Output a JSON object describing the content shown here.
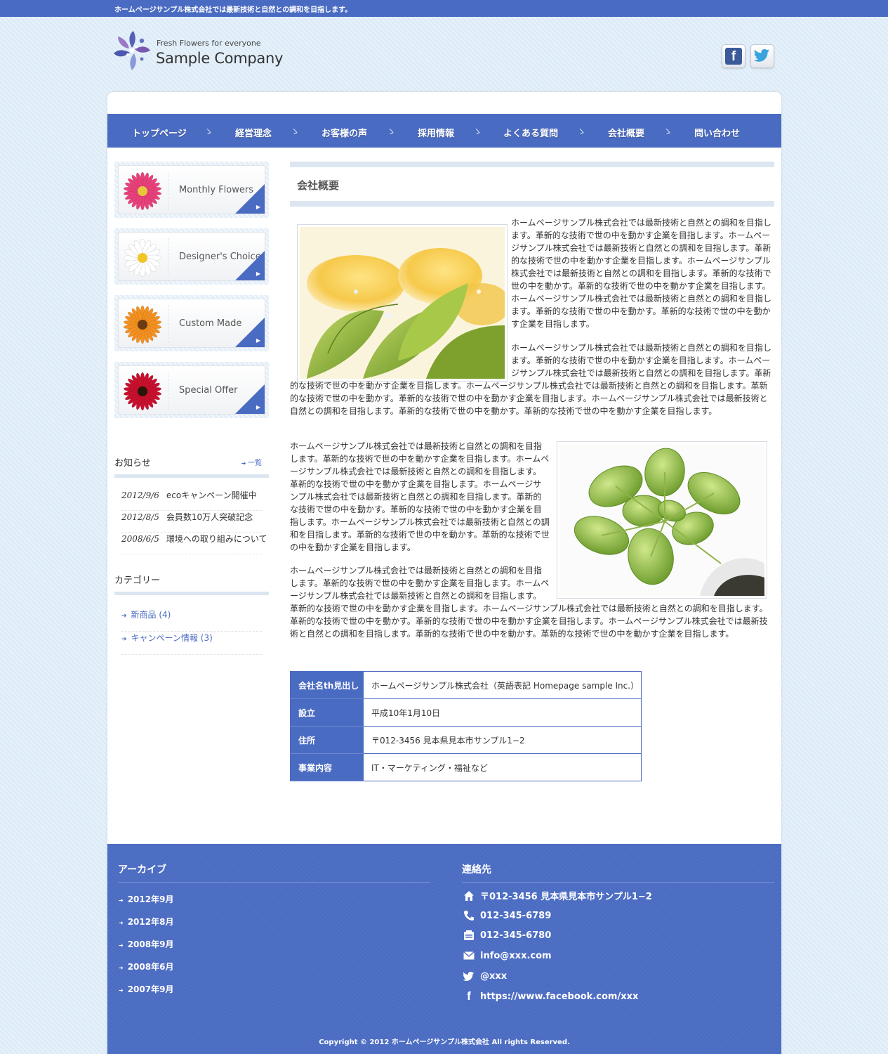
{
  "topbar": {
    "text": "ホームページサンプル株式会社では最新技術と自然との調和を目指します。"
  },
  "header": {
    "tagline": "Fresh Flowers for everyone",
    "company": "Sample Company",
    "social": {
      "facebook_icon": "facebook-icon",
      "twitter_icon": "twitter-icon"
    }
  },
  "nav": {
    "items": [
      "トップページ",
      "経営理念",
      "お客様の声",
      "採用情報",
      "よくある質問",
      "会社概要",
      "問い合わせ"
    ],
    "separator": "ゝ"
  },
  "sidebar": {
    "banners": [
      {
        "label": "Monthly Flowers",
        "flower_color": "#e8407a"
      },
      {
        "label": "Designer's Choice",
        "flower_color": "#ffffff"
      },
      {
        "label": "Custom Made",
        "flower_color": "#f39020"
      },
      {
        "label": "Special Offer",
        "flower_color": "#c8102e"
      }
    ],
    "news": {
      "title": "お知らせ",
      "more": "一覧",
      "items": [
        {
          "date": "2012/9/6",
          "text": "ecoキャンペーン開催中"
        },
        {
          "date": "2012/8/5",
          "text": "会員数10万人突破記念"
        },
        {
          "date": "2008/6/5",
          "text": "環境への取り組みについて"
        }
      ]
    },
    "categories": {
      "title": "カテゴリー",
      "items": [
        "新商品 (4)",
        "キャンペーン情報 (3)"
      ]
    }
  },
  "content": {
    "title": "会社概要",
    "paragraphs": [
      "ホームページサンプル株式会社では最新技術と自然との調和を目指します。革新的な技術で世の中を動かす企業を目指します。ホームページサンプル株式会社では最新技術と自然との調和を目指します。革新的な技術で世の中を動かす企業を目指します。ホームページサンプル株式会社では最新技術と自然との調和を目指します。革新的な技術で世の中を動かす。革新的な技術で世の中を動かす企業を目指します。ホームページサンプル株式会社では最新技術と自然との調和を目指します。革新的な技術で世の中を動かす。革新的な技術で世の中を動かす企業を目指します。",
      "ホームページサンプル株式会社では最新技術と自然との調和を目指します。革新的な技術で世の中を動かす企業を目指します。ホームページサンプル株式会社では最新技術と自然との調和を目指します。革新的な技術で世の中を動かす企業を目指します。ホームページサンプル株式会社では最新技術と自然との調和を目指します。革新的な技術で世の中を動かす。革新的な技術で世の中を動かす企業を目指します。ホームページサンプル株式会社では最新技術と自然との調和を目指します。革新的な技術で世の中を動かす。革新的な技術で世の中を動かす企業を目指します。",
      "ホームページサンプル株式会社では最新技術と自然との調和を目指します。革新的な技術で世の中を動かす企業を目指します。ホームページサンプル株式会社では最新技術と自然との調和を目指します。革新的な技術で世の中を動かす企業を目指します。ホームページサンプル株式会社では最新技術と自然との調和を目指します。革新的な技術で世の中を動かす。革新的な技術で世の中を動かす企業を目指します。ホームページサンプル株式会社では最新技術と自然との調和を目指します。革新的な技術で世の中を動かす。革新的な技術で世の中を動かす企業を目指します。",
      "ホームページサンプル株式会社では最新技術と自然との調和を目指します。革新的な技術で世の中を動かす企業を目指します。ホームページサンプル株式会社では最新技術と自然との調和を目指します。革新的な技術で世の中を動かす企業を目指します。ホームページサンプル株式会社では最新技術と自然との調和を目指します。革新的な技術で世の中を動かす。革新的な技術で世の中を動かす企業を目指します。ホームページサンプル株式会社では最新技術と自然との調和を目指します。革新的な技術で世の中を動かす。革新的な技術で世の中を動かす企業を目指します。"
    ],
    "table": [
      {
        "th": "会社名th見出し",
        "td": "ホームページサンプル株式会社（英語表記 Homepage sample Inc.）"
      },
      {
        "th": "設立",
        "td": "平成10年1月10日"
      },
      {
        "th": "住所",
        "td": "〒012-3456 見本県見本市サンプル1−2"
      },
      {
        "th": "事業内容",
        "td": "IT・マーケティング・福祉など"
      }
    ]
  },
  "footer": {
    "archive": {
      "title": "アーカイブ",
      "items": [
        "2012年9月",
        "2012年8月",
        "2008年9月",
        "2008年6月",
        "2007年9月"
      ]
    },
    "contact": {
      "title": "連絡先",
      "items": [
        {
          "icon": "home-icon",
          "text": "〒012-3456 見本県見本市サンプル1−2"
        },
        {
          "icon": "phone-icon",
          "text": "012-345-6789"
        },
        {
          "icon": "fax-icon",
          "text": "012-345-6780"
        },
        {
          "icon": "mail-icon",
          "text": "info@xxx.com"
        },
        {
          "icon": "twitter-icon",
          "text": "@xxx"
        },
        {
          "icon": "facebook-icon",
          "text": "https://www.facebook.com/xxx"
        }
      ]
    },
    "copyright": "Copyright © 2012 ホームページサンプル株式会社 All rights Reserved."
  },
  "colors": {
    "brand": "#4a6bc2",
    "background": "#dcebf7",
    "stripe": "#dce6f1"
  }
}
